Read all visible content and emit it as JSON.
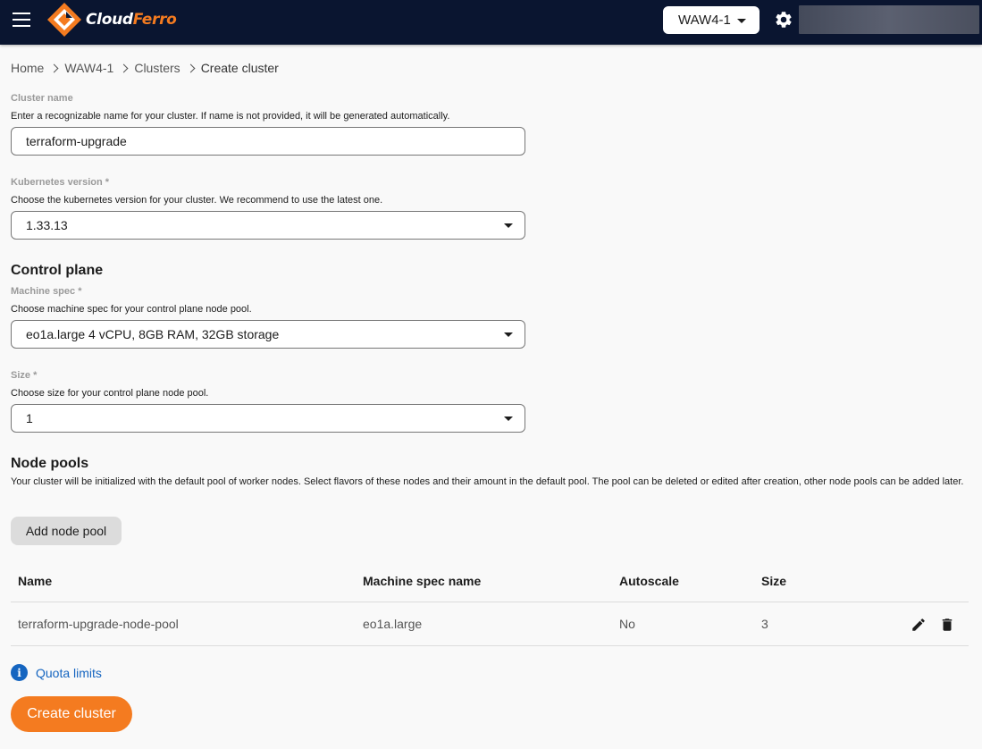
{
  "header": {
    "brand_part1": "Cloud",
    "brand_part2": "Ferro",
    "region": "WAW4-1",
    "brand_color": "#f47b20",
    "bar_color": "#0a1530"
  },
  "breadcrumb": {
    "items": [
      "Home",
      "WAW4-1",
      "Clusters"
    ],
    "current": "Create cluster"
  },
  "cluster_name": {
    "label": "Cluster name",
    "help": "Enter a recognizable name for your cluster. If name is not provided, it will be generated automatically.",
    "value": "terraform-upgrade"
  },
  "kubernetes_version": {
    "label": "Kubernetes version *",
    "help": "Choose the kubernetes version for your cluster. We recommend to use the latest one.",
    "value": "1.33.13"
  },
  "control_plane": {
    "title": "Control plane",
    "machine_spec": {
      "label": "Machine spec *",
      "help": "Choose machine spec for your control plane node pool.",
      "value": "eo1a.large 4 vCPU, 8GB RAM, 32GB storage"
    },
    "size": {
      "label": "Size *",
      "help": "Choose size for your control plane node pool.",
      "value": "1"
    }
  },
  "node_pools": {
    "title": "Node pools",
    "description": "Your cluster will be initialized with the default pool of worker nodes. Select flavors of these nodes and their amount in the default pool. The pool can be deleted or edited after creation, other node pools can be added later.",
    "add_button": "Add node pool",
    "columns": [
      "Name",
      "Machine spec name",
      "Autoscale",
      "Size"
    ],
    "rows": [
      {
        "name": "terraform-upgrade-node-pool",
        "machine_spec": "eo1a.large",
        "autoscale": "No",
        "size": "3"
      }
    ]
  },
  "quota_link": "Quota limits",
  "create_button": "Create cluster"
}
